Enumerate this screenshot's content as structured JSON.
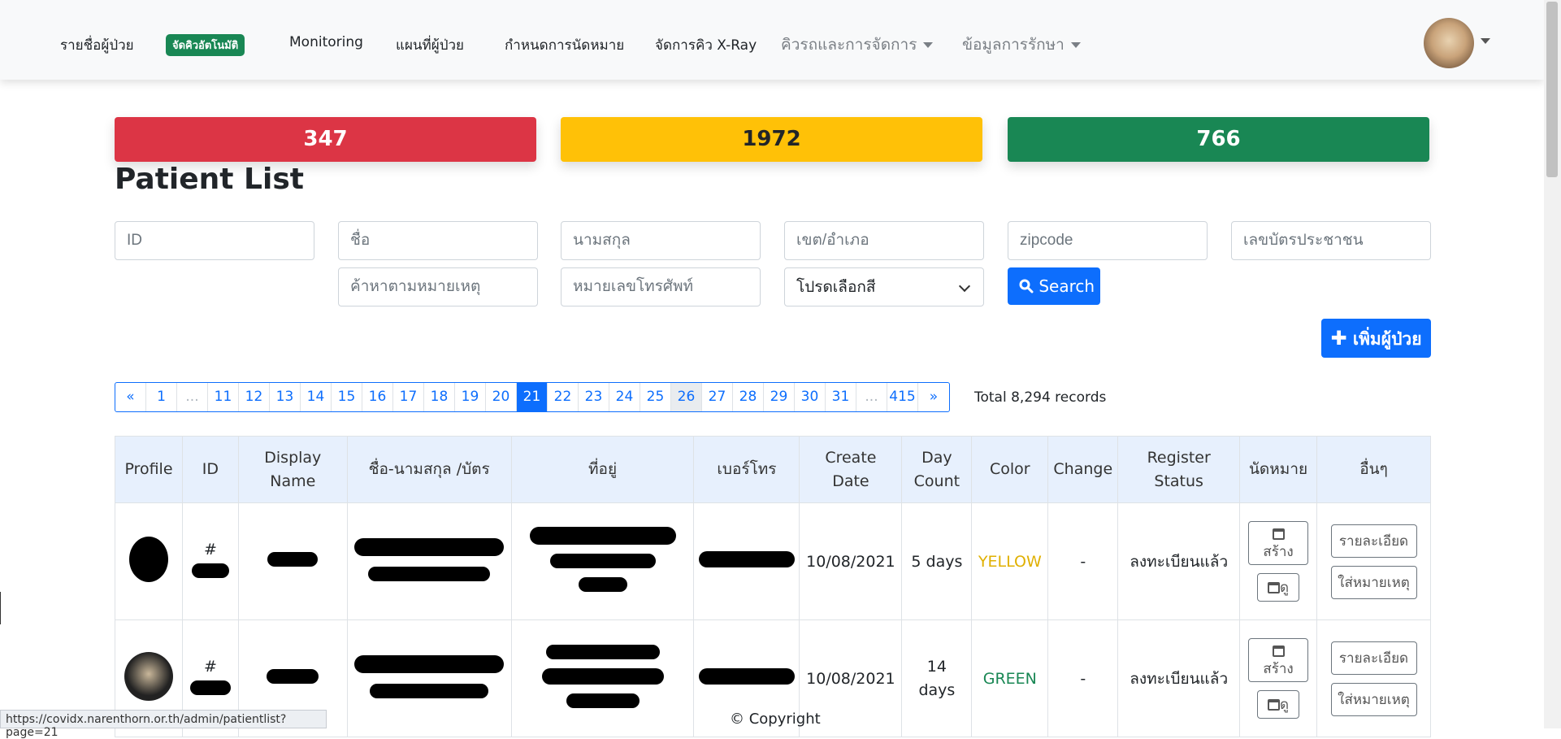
{
  "nav": {
    "items": [
      "รายชื่อผู้ป่วย",
      "จัดคิวอัตโนมัติ",
      "Monitoring",
      "แผนที่ผู้ป่วย",
      "กำหนดการนัดหมาย",
      "จัดการคิว X-Ray",
      "คิวรถและการจัดการ",
      "ข้อมูลการรักษา"
    ]
  },
  "stats": [
    {
      "value": "347",
      "color": "#dc3545"
    },
    {
      "value": "1972",
      "color": "#ffc107"
    },
    {
      "value": "766",
      "color": "#198754"
    }
  ],
  "page_title": "Patient List",
  "filters": {
    "id": "ID",
    "first_name": "ชื่อ",
    "last_name": "นามสกุล",
    "district": "เขต/อำเภอ",
    "zipcode": "zipcode",
    "citizen_id": "เลขบัตรประชาชน",
    "note": "ค้าหาตามหมายเหตุ",
    "phone": "หมายเลขโทรศัพท์",
    "color_select": "โปรดเลือกสี"
  },
  "search_button": "Search",
  "add_button": "เพิ่มผู้ป่วย",
  "pagination": {
    "pages": [
      "«",
      "1",
      "...",
      "11",
      "12",
      "13",
      "14",
      "15",
      "16",
      "17",
      "18",
      "19",
      "20",
      "21",
      "22",
      "23",
      "24",
      "25",
      "26",
      "27",
      "28",
      "29",
      "30",
      "31",
      "...",
      "415",
      "»"
    ],
    "current": "21",
    "total": "Total 8,294 records"
  },
  "table": {
    "headers": [
      "Profile",
      "ID",
      "Display Name",
      "ชื่อ-นามสกุล /บัตร",
      "ที่อยู่",
      "เบอร์โทร",
      "Create Date",
      "Day Count",
      "Color",
      "Change",
      "Register Status",
      "นัดหมาย",
      "อื่นๆ"
    ],
    "rows": [
      {
        "id": "#",
        "create_date": "10/08/2021",
        "day_count": "5 days",
        "color": "YELLOW",
        "color_hex": "#e0b000",
        "change": "-",
        "status": "ลงทะเบียนแล้ว",
        "create_btn": "สร้าง",
        "view_btn": "ดู",
        "detail_btn": "รายละเอียด",
        "note_btn": "ใส่หมายเหตุ"
      },
      {
        "id": "#",
        "create_date": "10/08/2021",
        "day_count": "14 days",
        "color": "GREEN",
        "color_hex": "#198754",
        "change": "-",
        "status": "ลงทะเบียนแล้ว",
        "create_btn": "สร้าง",
        "view_btn": "ดู",
        "detail_btn": "รายละเอียด",
        "note_btn": "ใส่หมายเหตุ"
      }
    ]
  },
  "footer": "© Copyright",
  "status_url": "https://covidx.narenthorn.or.th/admin/patientlist?page=21"
}
